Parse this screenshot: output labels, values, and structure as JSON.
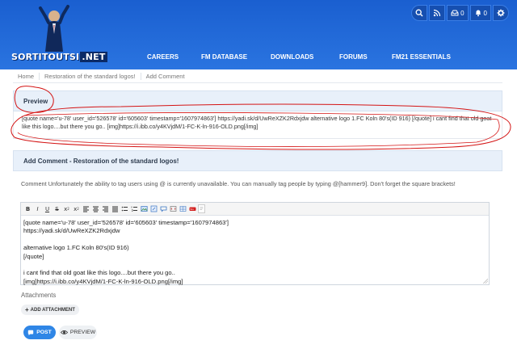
{
  "header": {
    "logo_text": "SORTITOUTSI",
    "logo_net": ".NET",
    "nav": [
      "CAREERS",
      "FM DATABASE",
      "DOWNLOADS",
      "FORUMS",
      "FM21 ESSENTIALS"
    ],
    "inbox_count": "0",
    "alerts_count": "0",
    "bg_color": "#2a74e0"
  },
  "breadcrumb": [
    "Home",
    "Restoration of the standard logos!",
    "Add Comment"
  ],
  "preview": {
    "heading": "Preview",
    "text": "[quote name='u-78' user_id='526578' id='605603' timestamp='1607974863'] https://yadi.sk/d/UwReXZK2Rdxjdw alternative logo 1.FC Koln 80's(ID 916) [/quote] i cant find that old goat like this logo....but there you go.. [img]https://i.ibb.co/y4KVjdM/1-FC-K-ln-916-OLD.png[/img]"
  },
  "comment": {
    "heading": "Add Comment - Restoration of the standard logos!",
    "info": "Comment Unfortunately the ability to tag users using @ is currently unavailable. You can manually tag people by typing @[hammer9]. Don't forget the square brackets!",
    "editor_text": "[quote name='u-78' user_id='526578' id='605603' timestamp='1607974863']\nhttps://yadi.sk/d/UwReXZK2Rdxjdw\n\nalternative logo 1.FC Koln 80's(ID 916)\n[/quote]\n\ni cant find that old goat like this logo....but there you go..\n[img]https://i.ibb.co/y4KVjdM/1-FC-K-ln-916-OLD.png[/img]",
    "toolbar_icons": [
      "bold-icon",
      "italic-icon",
      "underline-icon",
      "strikethrough-icon",
      "subscript-icon",
      "superscript-icon",
      "align-left-icon",
      "align-center-icon",
      "align-right-icon",
      "justify-icon",
      "bullet-list-icon",
      "numbered-list-icon",
      "image-icon",
      "link-icon",
      "quote-icon",
      "code-icon",
      "table-icon",
      "youtube-icon",
      "source-icon"
    ]
  },
  "attachments": {
    "label": "Attachments",
    "add_label": "ADD ATTACHMENT"
  },
  "buttons": {
    "post": "POST",
    "preview": "PREVIEW"
  },
  "annotation_color": "#d41414"
}
